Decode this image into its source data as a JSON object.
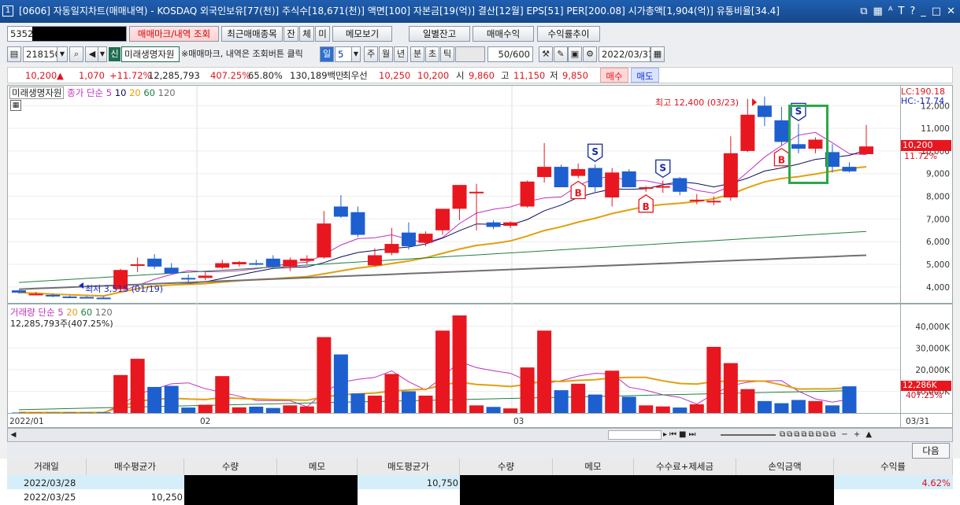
{
  "title_bar": {
    "window_no": "1",
    "text": "[0606] 자동일지차트(매매내역) - KOSDAQ 외국인보유[77(천)] 주식수[18,671(천)] 액면[100] 자본금[19(억)] 결산[12월] EPS[51] PER[200.08] 시가총액[1,904(억)] 유통비율[34.4]",
    "icons": [
      "window-icon",
      "chart-icon",
      "font-size-icon",
      "text-icon",
      "help-icon",
      "minimize-icon",
      "maximize-icon",
      "close-icon"
    ]
  },
  "toolbar1": {
    "account_prefix": "5352-",
    "buysell_mark_btn": "매매마크/내역 조회",
    "recent_btn": "최근매매종목",
    "tab_jan": "잔",
    "tab_che": "체",
    "tab_mi": "미",
    "memo_btn": "메모보기",
    "daily_balance_btn": "일별잔고",
    "trade_profit_btn": "매매수익",
    "return_trend_btn": "수익률추이"
  },
  "toolbar2": {
    "code": "218150",
    "badge": "신",
    "stock_name": "미래생명자원",
    "hint": "※매매마크, 내역은 조회버튼 클릭",
    "period_day": "일",
    "period_num": "5",
    "period_week": "주",
    "period_month": "월",
    "period_year": "년",
    "period_min": "분",
    "period_sec": "초",
    "period_tick": "틱",
    "count": "50/600",
    "date": "2022/03/31"
  },
  "price_bar": {
    "price": "10,200",
    "arrow": "▲",
    "change": "1,070",
    "change_pct": "+11.72%",
    "volume": "12,285,793",
    "vol_pct": "407.25%",
    "ratio": "65.80%",
    "amount": "130,189백만",
    "best_label": "최우선",
    "best_ask": "10,250",
    "best_bid": "10,200",
    "open_label": "시",
    "open": "9,860",
    "high_label": "고",
    "high": "11,150",
    "low_label": "저",
    "low": "9,850",
    "buy_btn": "매수",
    "sell_btn": "매도"
  },
  "price_panel": {
    "name_label": "미래생명자원",
    "ma_label": "종가 단순",
    "ma5": "5",
    "ma10": "10",
    "ma20": "20",
    "ma60": "60",
    "ma120": "120",
    "lc": "LC:190.18",
    "hc": "HC:-17.74",
    "high_note": "최고 12,400 (03/23)",
    "low_note": "최저 3,515 (01/19)",
    "cur_price_tag": "10,200",
    "cur_pct_tag": "11.72%"
  },
  "volume_panel": {
    "label": "거래량 단순",
    "ma5": "5",
    "ma20": "20",
    "ma60": "60",
    "ma120": "120",
    "info": "12,285,793주(407.25%)",
    "cur_tag": "12,286K",
    "cur_pct_tag": "407.25%"
  },
  "chart_data": [
    {
      "type": "candlestick",
      "y_ticks": [
        "4,000",
        "5,000",
        "6,000",
        "7,000",
        "8,000",
        "9,000",
        "10,000",
        "11,000",
        "12,000"
      ],
      "ylim": [
        3300,
        12600
      ],
      "x_labels": [
        "2022/01",
        "02",
        "03",
        "03/31"
      ],
      "candles": [
        [
          3850,
          3850,
          3700,
          3750
        ],
        [
          3700,
          3780,
          3650,
          3700
        ],
        [
          3650,
          3700,
          3550,
          3600
        ],
        [
          3580,
          3620,
          3515,
          3560
        ],
        [
          3560,
          3600,
          3500,
          3530
        ],
        [
          3530,
          3580,
          3480,
          3520
        ],
        [
          3900,
          4800,
          3850,
          4750
        ],
        [
          4950,
          5300,
          4650,
          5000
        ],
        [
          5250,
          5450,
          4800,
          4900
        ],
        [
          4850,
          5050,
          4550,
          4600
        ],
        [
          4400,
          4550,
          4150,
          4350
        ],
        [
          4400,
          4650,
          4300,
          4500
        ],
        [
          4850,
          5200,
          4800,
          5050
        ],
        [
          5000,
          5150,
          4900,
          5100
        ],
        [
          5050,
          5200,
          4950,
          5000
        ],
        [
          5250,
          5400,
          4850,
          4900
        ],
        [
          4900,
          5300,
          4700,
          5200
        ],
        [
          5150,
          5400,
          5000,
          5250
        ],
        [
          5300,
          7350,
          5250,
          6800
        ],
        [
          7550,
          8050,
          7050,
          7100
        ],
        [
          7300,
          7550,
          6200,
          6300
        ],
        [
          4950,
          5700,
          4900,
          5400
        ],
        [
          5500,
          6600,
          5400,
          5900
        ],
        [
          6400,
          6850,
          5650,
          5800
        ],
        [
          5950,
          6450,
          5800,
          6350
        ],
        [
          6500,
          7350,
          6300,
          7450
        ],
        [
          7450,
          8400,
          6950,
          8500
        ],
        [
          8200,
          8550,
          6500,
          8200
        ],
        [
          6850,
          6950,
          6550,
          6650
        ],
        [
          6700,
          6900,
          6600,
          6850
        ],
        [
          7550,
          8700,
          7500,
          8650
        ],
        [
          8850,
          10350,
          8600,
          9300
        ],
        [
          9300,
          9400,
          8700,
          8400
        ],
        [
          8900,
          9450,
          8800,
          9200
        ],
        [
          9250,
          9400,
          8200,
          8400
        ],
        [
          7950,
          9250,
          7550,
          9050
        ],
        [
          9100,
          9200,
          8400,
          8400
        ],
        [
          8350,
          8450,
          8200,
          8400
        ],
        [
          8400,
          8700,
          8150,
          8450
        ],
        [
          8800,
          8850,
          8050,
          8200
        ],
        [
          7800,
          8100,
          7650,
          7850
        ],
        [
          7750,
          8000,
          7600,
          7800
        ],
        [
          7950,
          10650,
          7800,
          9900
        ],
        [
          10000,
          12300,
          9950,
          11600
        ],
        [
          12000,
          12400,
          11100,
          11500
        ],
        [
          11350,
          11950,
          10250,
          10400
        ],
        [
          10300,
          11200,
          9900,
          10100
        ],
        [
          10100,
          10600,
          9900,
          10500
        ],
        [
          9950,
          10300,
          9050,
          9300
        ],
        [
          9300,
          9500,
          9050,
          9100
        ],
        [
          9860,
          11150,
          9850,
          10200
        ]
      ]
    },
    {
      "type": "bar",
      "name": "volume",
      "y_ticks": [
        "10,000K",
        "20,000K",
        "30,000K",
        "40,000K"
      ],
      "ylim": [
        0,
        45000
      ],
      "values": [
        200,
        150,
        180,
        220,
        190,
        300,
        17500,
        25000,
        12000,
        12500,
        2500,
        3800,
        17000,
        2600,
        2900,
        2300,
        3500,
        3000,
        35000,
        27000,
        9000,
        8000,
        18000,
        10000,
        8000,
        38000,
        45000,
        3500,
        2800,
        2100,
        21000,
        38000,
        10500,
        13500,
        8500,
        19500,
        7500,
        3500,
        3000,
        2500,
        4000,
        30500,
        23000,
        11000,
        5500,
        4500,
        6000,
        5500,
        3500,
        12300
      ],
      "colors_up": "#e8171f",
      "colors_down": "#1e5fd0"
    }
  ],
  "markers": [
    {
      "kind": "B",
      "bar": 33
    },
    {
      "kind": "S",
      "bar": 34
    },
    {
      "kind": "B",
      "bar": 37
    },
    {
      "kind": "S",
      "bar": 38
    },
    {
      "kind": "B",
      "bar": 45
    },
    {
      "kind": "S",
      "bar": 46
    }
  ],
  "grid": {
    "headers": [
      "거래일",
      "매수평균가",
      "수량",
      "메모",
      "매도평균가",
      "수량",
      "메모",
      "수수료+제세금",
      "손익금액",
      "수익률"
    ],
    "next_btn": "다음",
    "rows": [
      {
        "date": "2022/03/28",
        "buy_avg": "",
        "sell_avg": "10,750",
        "return": "4.62%"
      },
      {
        "date": "2022/03/25",
        "buy_avg": "10,250",
        "sell_avg": "",
        "return": ""
      }
    ]
  },
  "colors": {
    "up": "#e8171f",
    "down": "#1e5fd0",
    "ma5": "#c030c0",
    "ma10": "#0c0c5c",
    "ma20": "#e0a010",
    "ma60": "#208040",
    "ma120": "#707070",
    "highlight_box": "#2aa84a",
    "title_bg": "#1f5fb0"
  }
}
